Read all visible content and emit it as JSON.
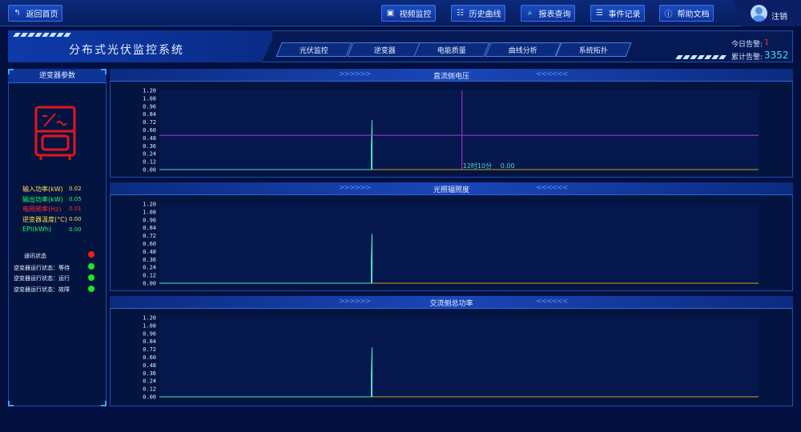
{
  "topbar": {
    "back_label": "返回首页",
    "buttons": [
      {
        "label": "视频监控",
        "icon": "video-icon"
      },
      {
        "label": "历史曲线",
        "icon": "chart-icon"
      },
      {
        "label": "报表查询",
        "icon": "search-icon"
      },
      {
        "label": "事件记录",
        "icon": "document-icon"
      },
      {
        "label": "帮助文档",
        "icon": "help-icon"
      }
    ],
    "logout_label": "注销"
  },
  "header": {
    "system_title": "分布式光伏监控系统",
    "nav_tabs": [
      "光伏监控",
      "逆变器",
      "电能质量",
      "曲线分析",
      "系统拓扑"
    ],
    "alarm_today_label": "今日告警:",
    "alarm_today_value": "1",
    "alarm_total_label": "累计告警:",
    "alarm_total_value": "3352"
  },
  "left_panel": {
    "title": "逆变器参数",
    "params": [
      {
        "label": "输入功率(kW)",
        "value": "0.02",
        "color": "#ffe14a"
      },
      {
        "label": "输出功率(kW)",
        "value": "0.05",
        "color": "#25ff5a"
      },
      {
        "label": "电网频率(Hz)",
        "value": "0.01",
        "color": "#ff2b2b"
      },
      {
        "label": "逆变器温度(°C)",
        "value": "0.00",
        "color": "#ffe14a"
      },
      {
        "label": "EPI(kWh)",
        "value": "0.00",
        "color": "#25ff5a"
      }
    ],
    "statuses": [
      {
        "label": "通讯状态",
        "color": "#ff1a1a"
      },
      {
        "label": "逆变器运行状态：等待",
        "color": "#1ee81e"
      },
      {
        "label": "逆变器运行状态：运行",
        "color": "#1ee81e"
      },
      {
        "label": "逆变器运行状态：故障",
        "color": "#1ee81e"
      }
    ]
  },
  "chart_data": [
    {
      "type": "line",
      "title": "直流侧电压",
      "yticks": [
        "1.20",
        "1.08",
        "0.96",
        "0.84",
        "0.72",
        "0.60",
        "0.48",
        "0.36",
        "0.24",
        "0.12",
        "0.00"
      ],
      "ylim": [
        0,
        1.2
      ],
      "spike": {
        "position": 0.355,
        "value": 0.75
      },
      "hline_value": 0.52,
      "hline_color": "#b03ad6",
      "cursor": {
        "position": 0.505,
        "label": "12时10分",
        "value": "0.00"
      }
    },
    {
      "type": "line",
      "title": "光照辐照度",
      "yticks": [
        "1.20",
        "1.08",
        "0.96",
        "0.84",
        "0.72",
        "0.60",
        "0.48",
        "0.36",
        "0.24",
        "0.12",
        "0.00"
      ],
      "ylim": [
        0,
        1.2
      ],
      "spike": {
        "position": 0.355,
        "value": 0.75
      }
    },
    {
      "type": "line",
      "title": "交流侧总功率",
      "yticks": [
        "1.20",
        "1.08",
        "0.96",
        "0.84",
        "0.72",
        "0.60",
        "0.48",
        "0.36",
        "0.24",
        "0.12",
        "0.00"
      ],
      "ylim": [
        0,
        1.2
      ],
      "spike": {
        "position": 0.355,
        "value": 0.75
      }
    }
  ],
  "colors": {
    "baseline_before": "#4fe6c8",
    "baseline_after": "#c9a019",
    "spike": "#4fe6c8"
  }
}
